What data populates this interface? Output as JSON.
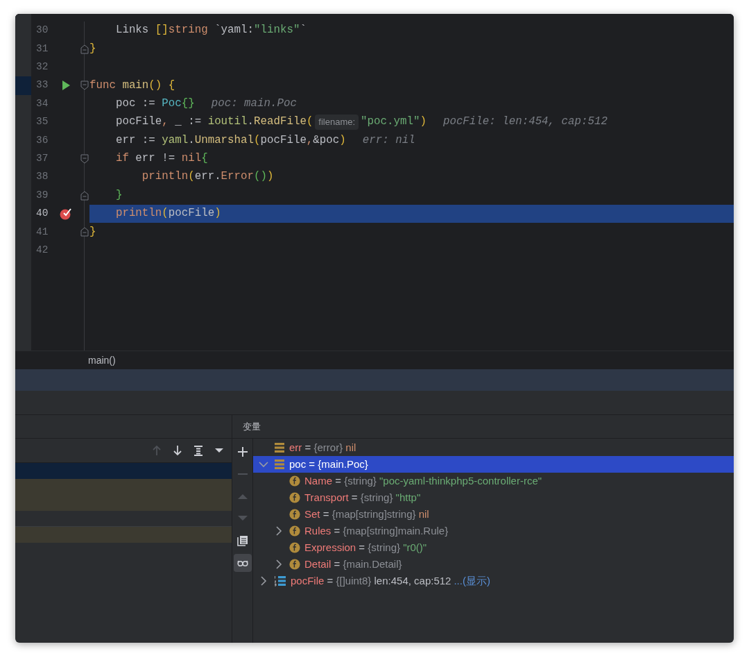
{
  "editor": {
    "lines": [
      {
        "number": "30",
        "tokens": [
          {
            "kind": "plain",
            "text": "    Links "
          },
          {
            "kind": "bracket",
            "text": "[]"
          },
          {
            "kind": "keyword",
            "text": "string"
          },
          {
            "kind": "plain",
            "text": " `yaml:"
          },
          {
            "kind": "string",
            "text": "\"links\""
          },
          {
            "kind": "plain",
            "text": "`"
          }
        ]
      },
      {
        "number": "31",
        "fold_end": true,
        "tokens": [
          {
            "kind": "bracket",
            "text": "}"
          }
        ]
      },
      {
        "number": "32"
      },
      {
        "number": "33",
        "fold_start": true,
        "run_marker": true,
        "bookmark": true,
        "tokens": [
          {
            "kind": "keyword",
            "text": "func "
          },
          {
            "kind": "call",
            "text": "main"
          },
          {
            "kind": "bracket",
            "text": "() {"
          }
        ]
      },
      {
        "number": "34",
        "tokens": [
          {
            "kind": "plain",
            "text": "    poc := "
          },
          {
            "kind": "type",
            "text": "Poc"
          },
          {
            "kind": "brace",
            "text": "{}"
          },
          {
            "kind": "hint",
            "text": "poc: main.Poc"
          }
        ]
      },
      {
        "number": "35",
        "tokens": [
          {
            "kind": "plain",
            "text": "    pocFile"
          },
          {
            "kind": "punct",
            "text": ","
          },
          {
            "kind": "plain",
            "text": " _ := "
          },
          {
            "kind": "package",
            "text": "ioutil"
          },
          {
            "kind": "plain",
            "text": "."
          },
          {
            "kind": "call",
            "text": "ReadFile"
          },
          {
            "kind": "bracket",
            "text": "("
          },
          {
            "kind": "inlay",
            "text": "filename:"
          },
          {
            "kind": "string",
            "text": "\"poc.yml\""
          },
          {
            "kind": "bracket",
            "text": ")"
          },
          {
            "kind": "hint",
            "text": "pocFile: len:454, cap:512"
          }
        ]
      },
      {
        "number": "36",
        "tokens": [
          {
            "kind": "plain",
            "text": "    err := "
          },
          {
            "kind": "package",
            "text": "yaml"
          },
          {
            "kind": "plain",
            "text": "."
          },
          {
            "kind": "call",
            "text": "Unmarshal"
          },
          {
            "kind": "bracket",
            "text": "("
          },
          {
            "kind": "plain",
            "text": "pocFile"
          },
          {
            "kind": "punct",
            "text": ","
          },
          {
            "kind": "plain",
            "text": "&poc"
          },
          {
            "kind": "bracket",
            "text": ")"
          },
          {
            "kind": "hint",
            "text": "err: nil"
          }
        ]
      },
      {
        "number": "37",
        "fold_start": true,
        "tokens": [
          {
            "kind": "keyword",
            "text": "    if"
          },
          {
            "kind": "plain",
            "text": " err != "
          },
          {
            "kind": "keyword",
            "text": "nil"
          },
          {
            "kind": "brace",
            "text": "{"
          }
        ]
      },
      {
        "number": "38",
        "tokens": [
          {
            "kind": "keyword",
            "text": "        println"
          },
          {
            "kind": "bracket",
            "text": "("
          },
          {
            "kind": "plain",
            "text": "err."
          },
          {
            "kind": "keyword",
            "text": "Error"
          },
          {
            "kind": "brace",
            "text": "()"
          },
          {
            "kind": "bracket",
            "text": ")"
          }
        ]
      },
      {
        "number": "39",
        "fold_end": true,
        "tokens": [
          {
            "kind": "brace",
            "text": "    }"
          }
        ]
      },
      {
        "number": "40",
        "breakpoint": true,
        "current": true,
        "tokens": [
          {
            "kind": "keyword",
            "text": "    println"
          },
          {
            "kind": "bracket",
            "text": "("
          },
          {
            "kind": "plain",
            "text": "pocFile"
          },
          {
            "kind": "bracket",
            "text": ")"
          }
        ]
      },
      {
        "number": "41",
        "fold_end": true,
        "tokens": [
          {
            "kind": "bracket",
            "text": "}"
          }
        ]
      },
      {
        "number": "42"
      }
    ]
  },
  "breadcrumb": "main()",
  "frames": {
    "toolbar": [
      {
        "kind": "up",
        "disabled": true
      },
      {
        "kind": "down",
        "disabled": false
      },
      {
        "kind": "list",
        "disabled": false
      },
      {
        "kind": "dropdown",
        "disabled": false
      }
    ],
    "rows": [
      {
        "kind": "plain",
        "selected": true
      },
      {
        "kind": "library",
        "selected": false
      },
      {
        "kind": "library",
        "selected": false
      },
      {
        "kind": "plain",
        "selected": false
      },
      {
        "kind": "library",
        "selected": false
      }
    ]
  },
  "variables": {
    "title": "变量",
    "toolbar": [
      {
        "kind": "add",
        "disabled": false,
        "on": false
      },
      {
        "kind": "remove",
        "disabled": true,
        "on": false
      },
      {
        "kind": "up",
        "disabled": true,
        "on": false
      },
      {
        "kind": "down",
        "disabled": true,
        "on": false
      },
      {
        "kind": "copy",
        "disabled": false,
        "on": false
      },
      {
        "kind": "glasses",
        "disabled": false,
        "on": true
      }
    ],
    "items": [
      {
        "kind": "var",
        "name": "err",
        "operator": "=",
        "type": "{error}",
        "value": {
          "kind": "nil",
          "text": "nil"
        },
        "selected": false
      },
      {
        "kind": "var",
        "name": "poc",
        "operator": "=",
        "type": "{main.Poc}",
        "selected": true,
        "expanded": true,
        "children": [
          {
            "kind": "field",
            "name": "Name",
            "operator": "=",
            "type": "{string}",
            "value": {
              "kind": "string",
              "text": "\"poc-yaml-thinkphp5-controller-rce\""
            },
            "selected": false
          },
          {
            "kind": "field",
            "name": "Transport",
            "operator": "=",
            "type": "{string}",
            "value": {
              "kind": "string",
              "text": "\"http\""
            },
            "selected": false
          },
          {
            "kind": "field",
            "name": "Set",
            "operator": "=",
            "type": "{map[string]string}",
            "value": {
              "kind": "nil",
              "text": "nil"
            },
            "selected": false
          },
          {
            "kind": "field",
            "name": "Rules",
            "operator": "=",
            "type": "{map[string]main.Rule}",
            "selected": false,
            "expanded": false
          },
          {
            "kind": "field",
            "name": "Expression",
            "operator": "=",
            "type": "{string}",
            "value": {
              "kind": "string",
              "text": "\"r0()\""
            },
            "selected": false
          },
          {
            "kind": "field",
            "name": "Detail",
            "operator": "=",
            "type": "{main.Detail}",
            "selected": false,
            "expanded": false
          }
        ]
      },
      {
        "kind": "array",
        "name": "pocFile",
        "operator": "=",
        "type": "{[]uint8}",
        "value": {
          "kind": "plain",
          "text": "len:454, cap:512"
        },
        "link": "...(显示)",
        "selected": false,
        "expanded": false
      }
    ]
  }
}
